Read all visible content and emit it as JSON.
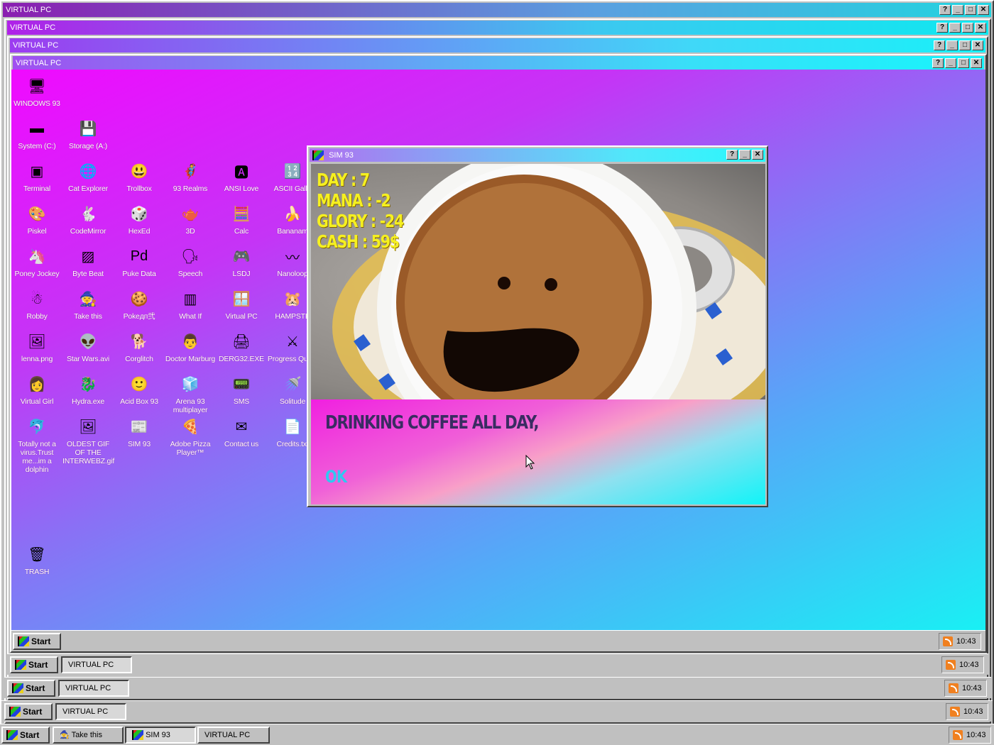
{
  "windows": [
    {
      "title": "VIRTUAL PC"
    },
    {
      "title": "VIRTUAL PC"
    },
    {
      "title": "VIRTUAL PC"
    },
    {
      "title": "VIRTUAL PC"
    }
  ],
  "titlebar_buttons": {
    "help": "?",
    "minimize": "_",
    "maximize": "□",
    "close": "✕"
  },
  "desktop_icons": [
    {
      "label": "WINDOWS 93",
      "icon": "computer-icon",
      "glyph": "🖥"
    },
    {
      "label": "System (C:)",
      "icon": "drive-icon",
      "glyph": "▬"
    },
    {
      "label": "Storage (A:)",
      "icon": "floppy-drive-icon",
      "glyph": "💾"
    },
    {
      "label": "Terminal",
      "icon": "terminal-icon",
      "glyph": "▣"
    },
    {
      "label": "Cat Explorer",
      "icon": "cat-explorer-icon",
      "glyph": "🌐"
    },
    {
      "label": "Trollbox",
      "icon": "trollbox-icon",
      "glyph": "😃"
    },
    {
      "label": "93 Realms",
      "icon": "realms-icon",
      "glyph": "🦸"
    },
    {
      "label": "ANSI Love",
      "icon": "ansi-love-icon",
      "glyph": "🅰"
    },
    {
      "label": "ASCII Galle",
      "icon": "ascii-gallery-icon",
      "glyph": "🔢"
    },
    {
      "label": "Piskel",
      "icon": "palette-icon",
      "glyph": "🎨"
    },
    {
      "label": "CodeMirror",
      "icon": "codemirror-icon",
      "glyph": "🐇"
    },
    {
      "label": "HexEd",
      "icon": "hexed-icon",
      "glyph": "🎲"
    },
    {
      "label": "3D",
      "icon": "teapot-icon",
      "glyph": "🫖"
    },
    {
      "label": "Calc",
      "icon": "calculator-icon",
      "glyph": "🧮"
    },
    {
      "label": "Bananam",
      "icon": "banana-icon",
      "glyph": "🍌"
    },
    {
      "label": "Poney Jockey",
      "icon": "pony-icon",
      "glyph": "🦄"
    },
    {
      "label": "Byte Beat",
      "icon": "bytebeat-icon",
      "glyph": "▨"
    },
    {
      "label": "Puke Data",
      "icon": "pd-icon",
      "glyph": "Pd"
    },
    {
      "label": "Speech",
      "icon": "speech-icon",
      "glyph": "🗣"
    },
    {
      "label": "LSDJ",
      "icon": "lsdj-icon",
      "glyph": "🎮"
    },
    {
      "label": "Nanoloop",
      "icon": "nanoloop-icon",
      "glyph": "〰"
    },
    {
      "label": "Robby",
      "icon": "robby-icon",
      "glyph": "☃"
    },
    {
      "label": "Take this",
      "icon": "take-this-icon",
      "glyph": "🧙"
    },
    {
      "label": "Pokeдп弐",
      "icon": "poke-icon",
      "glyph": "🍪"
    },
    {
      "label": "What If",
      "icon": "what-if-icon",
      "glyph": "▥"
    },
    {
      "label": "Virtual PC",
      "icon": "virtual-pc-icon",
      "glyph": "🪟"
    },
    {
      "label": "HAMPSTE",
      "icon": "hamster-icon",
      "glyph": "🐹"
    },
    {
      "label": "lenna.png",
      "icon": "image-file-icon",
      "glyph": "🖼"
    },
    {
      "label": "Star Wars.avi",
      "icon": "yoda-icon",
      "glyph": "👽"
    },
    {
      "label": "Corglitch",
      "icon": "corgi-icon",
      "glyph": "🐕"
    },
    {
      "label": "Doctor Marburg",
      "icon": "doctor-icon",
      "glyph": "👨"
    },
    {
      "label": "DERG32.EXE",
      "icon": "derg-icon",
      "glyph": "🖨"
    },
    {
      "label": "Progress Quest",
      "icon": "progress-quest-icon",
      "glyph": "⚔"
    },
    {
      "label": "Virtual Girl",
      "icon": "virtual-girl-icon",
      "glyph": "👩"
    },
    {
      "label": "Hydra.exe",
      "icon": "hydra-icon",
      "glyph": "🐉"
    },
    {
      "label": "Acid Box 93",
      "icon": "smiley-icon",
      "glyph": "🙂"
    },
    {
      "label": "Arena 93 multiplayer",
      "icon": "arena-cube-icon",
      "glyph": "🧊"
    },
    {
      "label": "SMS",
      "icon": "sms-icon",
      "glyph": "📟"
    },
    {
      "label": "Solitude",
      "icon": "solitude-icon",
      "glyph": "🚿"
    },
    {
      "label": "Totally not a virus.Trust me...im a dolphin",
      "icon": "dolphin-icon",
      "glyph": "🐬"
    },
    {
      "label": "OLDEST GIF OF THE INTERWEBZ.gif",
      "icon": "gif-file-icon",
      "glyph": "🖼"
    },
    {
      "label": "SIM 93",
      "icon": "sim93-icon",
      "glyph": "📰"
    },
    {
      "label": "Adobe Pizza Player™",
      "icon": "pizza-icon",
      "glyph": "🍕"
    },
    {
      "label": "Contact us",
      "icon": "contact-icon",
      "glyph": "✉"
    },
    {
      "label": "Credits.txt",
      "icon": "text-file-icon",
      "glyph": "📄"
    },
    {
      "label": "TRASH",
      "icon": "trash-icon",
      "glyph": "🗑"
    }
  ],
  "sim93": {
    "title": "SIM 93",
    "stats": {
      "day": "DAY : 7",
      "mana": "MANA : -2",
      "glory": "GLORY : -24",
      "cash": "CASH : 59$"
    },
    "message": "DRINKING COFFEE ALL DAY,",
    "ok_label": "OK"
  },
  "taskbars": [
    {
      "start": "Start",
      "tasks": [],
      "clock": "10:43"
    },
    {
      "start": "Start",
      "tasks": [
        "VIRTUAL PC"
      ],
      "clock": "10:43"
    },
    {
      "start": "Start",
      "tasks": [
        "VIRTUAL PC"
      ],
      "clock": "10:43"
    },
    {
      "start": "Start",
      "tasks": [
        "VIRTUAL PC"
      ],
      "clock": "10:43"
    },
    {
      "start": "Start",
      "tasks": [
        "Take this",
        "SIM 93",
        "VIRTUAL PC"
      ],
      "clock": "10:43"
    }
  ],
  "colors": {
    "stat_yellow": "#f5f020",
    "message_text": "#3a2c62",
    "ok_text": "#30c8f0"
  }
}
